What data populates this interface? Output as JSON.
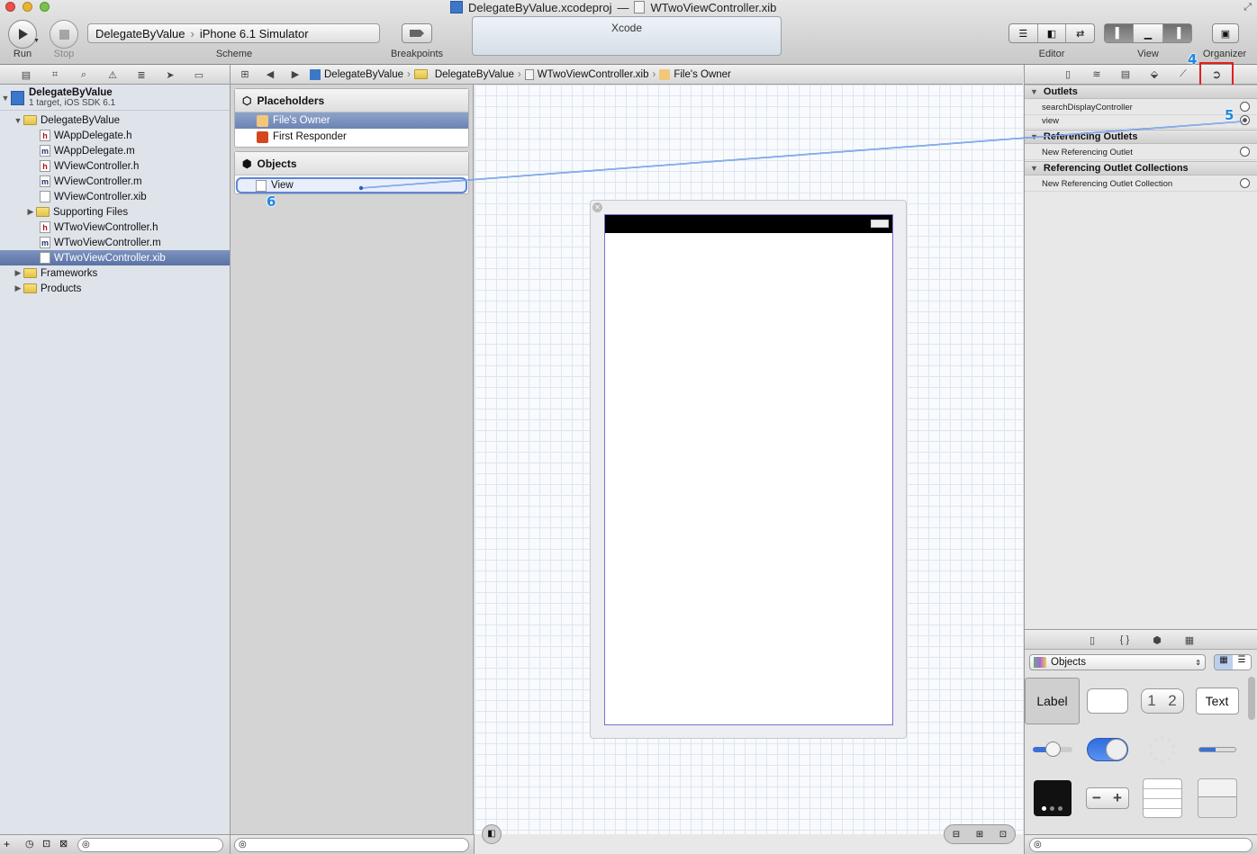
{
  "window": {
    "title_project": "DelegateByValue.xcodeproj",
    "title_sep": "—",
    "title_file": "WTwoViewController.xib"
  },
  "toolbar": {
    "run_label": "Run",
    "stop_label": "Stop",
    "scheme_target": "DelegateByValue",
    "scheme_sep": "›",
    "scheme_device": "iPhone 6.1 Simulator",
    "scheme_label": "Scheme",
    "breakpoints_label": "Breakpoints",
    "activity_text": "Xcode",
    "editor_label": "Editor",
    "view_label": "View",
    "organizer_label": "Organizer"
  },
  "navigator": {
    "project_name": "DelegateByValue",
    "project_sub": "1 target, iOS SDK 6.1",
    "items": [
      {
        "label": "DelegateByValue",
        "kind": "folder"
      },
      {
        "label": "WAppDelegate.h",
        "kind": "h"
      },
      {
        "label": "WAppDelegate.m",
        "kind": "m"
      },
      {
        "label": "WViewController.h",
        "kind": "h"
      },
      {
        "label": "WViewController.m",
        "kind": "m"
      },
      {
        "label": "WViewController.xib",
        "kind": "xib"
      },
      {
        "label": "Supporting Files",
        "kind": "folder"
      },
      {
        "label": "WTwoViewController.h",
        "kind": "h"
      },
      {
        "label": "WTwoViewController.m",
        "kind": "m"
      },
      {
        "label": "WTwoViewController.xib",
        "kind": "xib"
      },
      {
        "label": "Frameworks",
        "kind": "folder"
      },
      {
        "label": "Products",
        "kind": "folder"
      }
    ],
    "file_letters": {
      "h": "h",
      "m": "m"
    }
  },
  "jumpbar": {
    "crumbs": [
      "DelegateByValue",
      "DelegateByValue",
      "WTwoViewController.xib",
      "File's Owner"
    ],
    "sep": "›"
  },
  "outline": {
    "placeholders_title": "Placeholders",
    "files_owner": "File's Owner",
    "first_responder": "First Responder",
    "objects_title": "Objects",
    "view_label": "View"
  },
  "inspector": {
    "outlets_title": "Outlets",
    "outlet_1": "searchDisplayController",
    "outlet_2": "view",
    "ref_outlets_title": "Referencing Outlets",
    "new_ref_outlet": "New Referencing Outlet",
    "ref_collections_title": "Referencing Outlet Collections",
    "new_ref_collection": "New Referencing Outlet Collection"
  },
  "library": {
    "selector_value": "Objects",
    "label_item": "Label",
    "segmented_1": "1",
    "segmented_2": "2",
    "text_item": "Text",
    "stepper_minus": "−",
    "stepper_plus": "+"
  },
  "badges": {
    "b4": "4",
    "b5": "5",
    "b6": "6"
  },
  "colors": {
    "accent": "#1e88e5",
    "selection": "#5a73a6",
    "annotation_box": "#e0201c"
  }
}
